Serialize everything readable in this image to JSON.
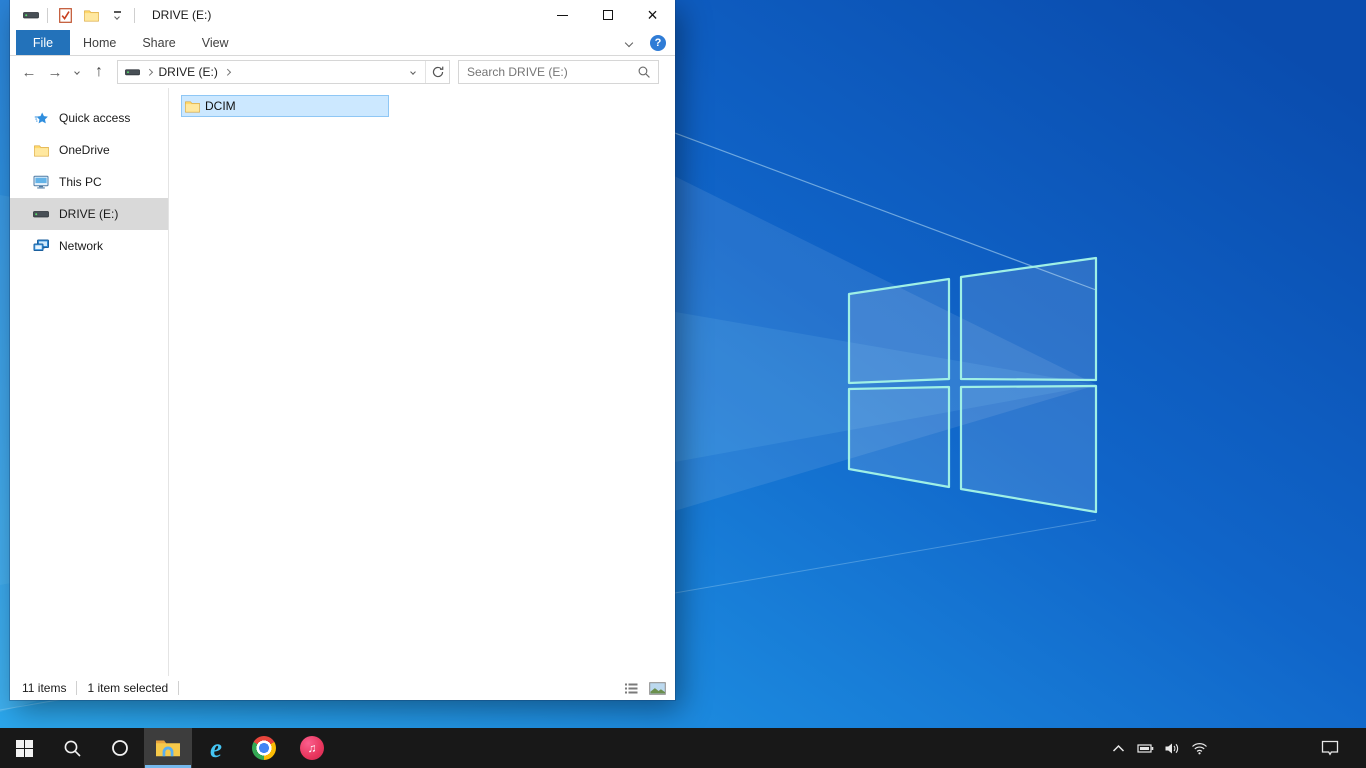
{
  "colors": {
    "accent_blue": "#2372ba",
    "selection_fill": "#cce8ff",
    "selection_border": "#8fc7f5",
    "sidebar_selected": "#d9d9d9",
    "taskbar_bg": "#181818",
    "taskbar_active_underline": "#76b9ed",
    "desktop_blue_light": "#2ba6ec",
    "desktop_blue_dark": "#0a4cae",
    "logo_stroke": "#9ff0e6"
  },
  "glyphs": {
    "back": "←",
    "forward": "→",
    "up": "↑",
    "help": "?",
    "close": "×",
    "ie": "e",
    "itunes_note": "♫"
  },
  "explorer": {
    "titlebar": {
      "title": "DRIVE (E:)",
      "qat_icons": [
        "drive-icon",
        "properties-icon",
        "new-folder-icon",
        "customize-quick-access-chevron"
      ]
    },
    "tabs": [
      {
        "label": "File",
        "active": true
      },
      {
        "label": "Home",
        "active": false
      },
      {
        "label": "Share",
        "active": false
      },
      {
        "label": "View",
        "active": false
      }
    ],
    "address": {
      "breadcrumb_location": "DRIVE (E:)",
      "search_placeholder": "Search DRIVE (E:)"
    },
    "sidebar": {
      "items": [
        {
          "label": "Quick access",
          "icon": "quick-access-star-icon",
          "selected": false
        },
        {
          "label": "OneDrive",
          "icon": "onedrive-folder-icon",
          "selected": false
        },
        {
          "label": "This PC",
          "icon": "this-pc-icon",
          "selected": false
        },
        {
          "label": "DRIVE (E:)",
          "icon": "drive-icon",
          "selected": true
        },
        {
          "label": "Network",
          "icon": "network-icon",
          "selected": false
        }
      ]
    },
    "files": [
      {
        "name": "DCIM",
        "icon": "folder-icon",
        "selected": true
      }
    ],
    "statusbar": {
      "item_count": "11 items",
      "selection": "1 item selected",
      "view_toggles": [
        "details-view-icon",
        "thumbnails-view-icon"
      ]
    }
  },
  "taskbar": {
    "buttons": [
      {
        "icon": "start-icon",
        "active": false
      },
      {
        "icon": "search-icon",
        "active": false
      },
      {
        "icon": "cortana-icon",
        "active": false
      },
      {
        "icon": "file-explorer-icon",
        "active": true
      },
      {
        "icon": "internet-explorer-icon",
        "active": false
      },
      {
        "icon": "chrome-icon",
        "active": false
      },
      {
        "icon": "itunes-icon",
        "active": false
      }
    ],
    "tray_icons": [
      "tray-expand-chevron-icon",
      "battery-icon",
      "volume-icon",
      "wifi-icon"
    ],
    "action_center": "action-center-icon"
  }
}
